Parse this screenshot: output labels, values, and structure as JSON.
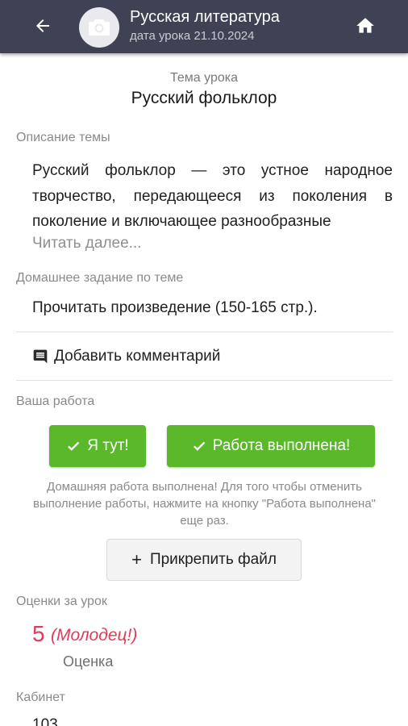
{
  "header": {
    "title": "Русская литература",
    "subtitle": "дата урока 21.10.2024",
    "back_icon": "arrow-left-icon",
    "avatar_icon": "camera-icon",
    "home_icon": "home-icon"
  },
  "topic": {
    "label": "Тема урока",
    "title": "Русский фольклор"
  },
  "description": {
    "label": "Описание темы",
    "text": "Русский фольклор — это устное народное творчество, передающееся из поколения в поколение и включающее разнообразные",
    "read_more": "Читать далее..."
  },
  "homework": {
    "label": "Домашнее задание по теме",
    "text": "Прочитать произведение (150-165 стр.)."
  },
  "comment": {
    "label": "Добавить комментарий",
    "icon": "comment-icon"
  },
  "work": {
    "label": "Ваша работа",
    "here_button": "Я тут!",
    "done_button": "Работа выполнена!",
    "note": "Домашняя работа выполнена! Для того чтобы отменить выполнение работы, нажмите на кнопку \"Работа выполнена\" еще раз.",
    "attach_button": "Прикрепить файл"
  },
  "grades": {
    "label": "Оценки за урок",
    "value": "5",
    "comment": "(Молодец!)",
    "caption": "Оценка"
  },
  "cabinet": {
    "label": "Кабинет",
    "value": "103"
  },
  "colors": {
    "appbar": "#3e4254",
    "accent_green": "#5cb82b",
    "grade_red": "#e23a5a"
  }
}
